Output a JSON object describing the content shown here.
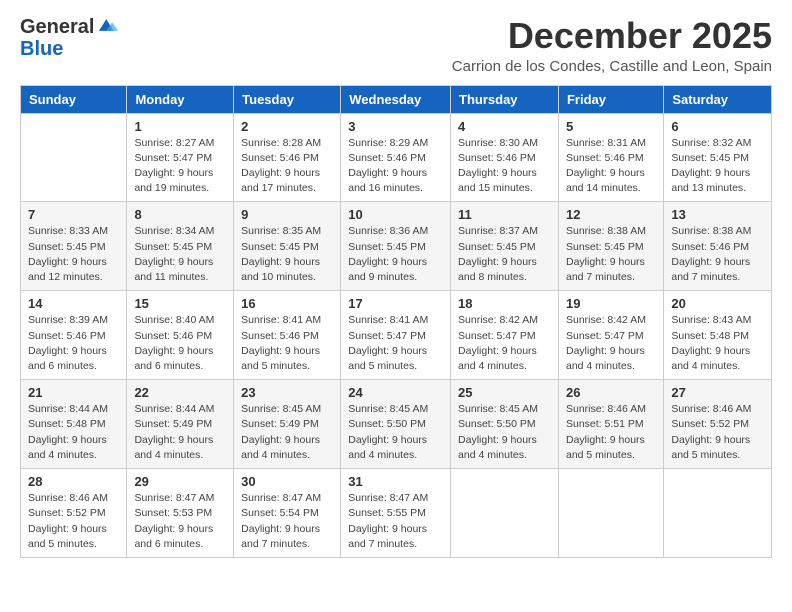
{
  "logo": {
    "line1": "General",
    "line2": "Blue"
  },
  "title": "December 2025",
  "location": "Carrion de los Condes, Castille and Leon, Spain",
  "weekdays": [
    "Sunday",
    "Monday",
    "Tuesday",
    "Wednesday",
    "Thursday",
    "Friday",
    "Saturday"
  ],
  "weeks": [
    [
      {
        "day": "",
        "sunrise": "",
        "sunset": "",
        "daylight": ""
      },
      {
        "day": "1",
        "sunrise": "Sunrise: 8:27 AM",
        "sunset": "Sunset: 5:47 PM",
        "daylight": "Daylight: 9 hours and 19 minutes."
      },
      {
        "day": "2",
        "sunrise": "Sunrise: 8:28 AM",
        "sunset": "Sunset: 5:46 PM",
        "daylight": "Daylight: 9 hours and 17 minutes."
      },
      {
        "day": "3",
        "sunrise": "Sunrise: 8:29 AM",
        "sunset": "Sunset: 5:46 PM",
        "daylight": "Daylight: 9 hours and 16 minutes."
      },
      {
        "day": "4",
        "sunrise": "Sunrise: 8:30 AM",
        "sunset": "Sunset: 5:46 PM",
        "daylight": "Daylight: 9 hours and 15 minutes."
      },
      {
        "day": "5",
        "sunrise": "Sunrise: 8:31 AM",
        "sunset": "Sunset: 5:46 PM",
        "daylight": "Daylight: 9 hours and 14 minutes."
      },
      {
        "day": "6",
        "sunrise": "Sunrise: 8:32 AM",
        "sunset": "Sunset: 5:45 PM",
        "daylight": "Daylight: 9 hours and 13 minutes."
      }
    ],
    [
      {
        "day": "7",
        "sunrise": "Sunrise: 8:33 AM",
        "sunset": "Sunset: 5:45 PM",
        "daylight": "Daylight: 9 hours and 12 minutes."
      },
      {
        "day": "8",
        "sunrise": "Sunrise: 8:34 AM",
        "sunset": "Sunset: 5:45 PM",
        "daylight": "Daylight: 9 hours and 11 minutes."
      },
      {
        "day": "9",
        "sunrise": "Sunrise: 8:35 AM",
        "sunset": "Sunset: 5:45 PM",
        "daylight": "Daylight: 9 hours and 10 minutes."
      },
      {
        "day": "10",
        "sunrise": "Sunrise: 8:36 AM",
        "sunset": "Sunset: 5:45 PM",
        "daylight": "Daylight: 9 hours and 9 minutes."
      },
      {
        "day": "11",
        "sunrise": "Sunrise: 8:37 AM",
        "sunset": "Sunset: 5:45 PM",
        "daylight": "Daylight: 9 hours and 8 minutes."
      },
      {
        "day": "12",
        "sunrise": "Sunrise: 8:38 AM",
        "sunset": "Sunset: 5:45 PM",
        "daylight": "Daylight: 9 hours and 7 minutes."
      },
      {
        "day": "13",
        "sunrise": "Sunrise: 8:38 AM",
        "sunset": "Sunset: 5:46 PM",
        "daylight": "Daylight: 9 hours and 7 minutes."
      }
    ],
    [
      {
        "day": "14",
        "sunrise": "Sunrise: 8:39 AM",
        "sunset": "Sunset: 5:46 PM",
        "daylight": "Daylight: 9 hours and 6 minutes."
      },
      {
        "day": "15",
        "sunrise": "Sunrise: 8:40 AM",
        "sunset": "Sunset: 5:46 PM",
        "daylight": "Daylight: 9 hours and 6 minutes."
      },
      {
        "day": "16",
        "sunrise": "Sunrise: 8:41 AM",
        "sunset": "Sunset: 5:46 PM",
        "daylight": "Daylight: 9 hours and 5 minutes."
      },
      {
        "day": "17",
        "sunrise": "Sunrise: 8:41 AM",
        "sunset": "Sunset: 5:47 PM",
        "daylight": "Daylight: 9 hours and 5 minutes."
      },
      {
        "day": "18",
        "sunrise": "Sunrise: 8:42 AM",
        "sunset": "Sunset: 5:47 PM",
        "daylight": "Daylight: 9 hours and 4 minutes."
      },
      {
        "day": "19",
        "sunrise": "Sunrise: 8:42 AM",
        "sunset": "Sunset: 5:47 PM",
        "daylight": "Daylight: 9 hours and 4 minutes."
      },
      {
        "day": "20",
        "sunrise": "Sunrise: 8:43 AM",
        "sunset": "Sunset: 5:48 PM",
        "daylight": "Daylight: 9 hours and 4 minutes."
      }
    ],
    [
      {
        "day": "21",
        "sunrise": "Sunrise: 8:44 AM",
        "sunset": "Sunset: 5:48 PM",
        "daylight": "Daylight: 9 hours and 4 minutes."
      },
      {
        "day": "22",
        "sunrise": "Sunrise: 8:44 AM",
        "sunset": "Sunset: 5:49 PM",
        "daylight": "Daylight: 9 hours and 4 minutes."
      },
      {
        "day": "23",
        "sunrise": "Sunrise: 8:45 AM",
        "sunset": "Sunset: 5:49 PM",
        "daylight": "Daylight: 9 hours and 4 minutes."
      },
      {
        "day": "24",
        "sunrise": "Sunrise: 8:45 AM",
        "sunset": "Sunset: 5:50 PM",
        "daylight": "Daylight: 9 hours and 4 minutes."
      },
      {
        "day": "25",
        "sunrise": "Sunrise: 8:45 AM",
        "sunset": "Sunset: 5:50 PM",
        "daylight": "Daylight: 9 hours and 4 minutes."
      },
      {
        "day": "26",
        "sunrise": "Sunrise: 8:46 AM",
        "sunset": "Sunset: 5:51 PM",
        "daylight": "Daylight: 9 hours and 5 minutes."
      },
      {
        "day": "27",
        "sunrise": "Sunrise: 8:46 AM",
        "sunset": "Sunset: 5:52 PM",
        "daylight": "Daylight: 9 hours and 5 minutes."
      }
    ],
    [
      {
        "day": "28",
        "sunrise": "Sunrise: 8:46 AM",
        "sunset": "Sunset: 5:52 PM",
        "daylight": "Daylight: 9 hours and 5 minutes."
      },
      {
        "day": "29",
        "sunrise": "Sunrise: 8:47 AM",
        "sunset": "Sunset: 5:53 PM",
        "daylight": "Daylight: 9 hours and 6 minutes."
      },
      {
        "day": "30",
        "sunrise": "Sunrise: 8:47 AM",
        "sunset": "Sunset: 5:54 PM",
        "daylight": "Daylight: 9 hours and 7 minutes."
      },
      {
        "day": "31",
        "sunrise": "Sunrise: 8:47 AM",
        "sunset": "Sunset: 5:55 PM",
        "daylight": "Daylight: 9 hours and 7 minutes."
      },
      {
        "day": "",
        "sunrise": "",
        "sunset": "",
        "daylight": ""
      },
      {
        "day": "",
        "sunrise": "",
        "sunset": "",
        "daylight": ""
      },
      {
        "day": "",
        "sunrise": "",
        "sunset": "",
        "daylight": ""
      }
    ]
  ]
}
